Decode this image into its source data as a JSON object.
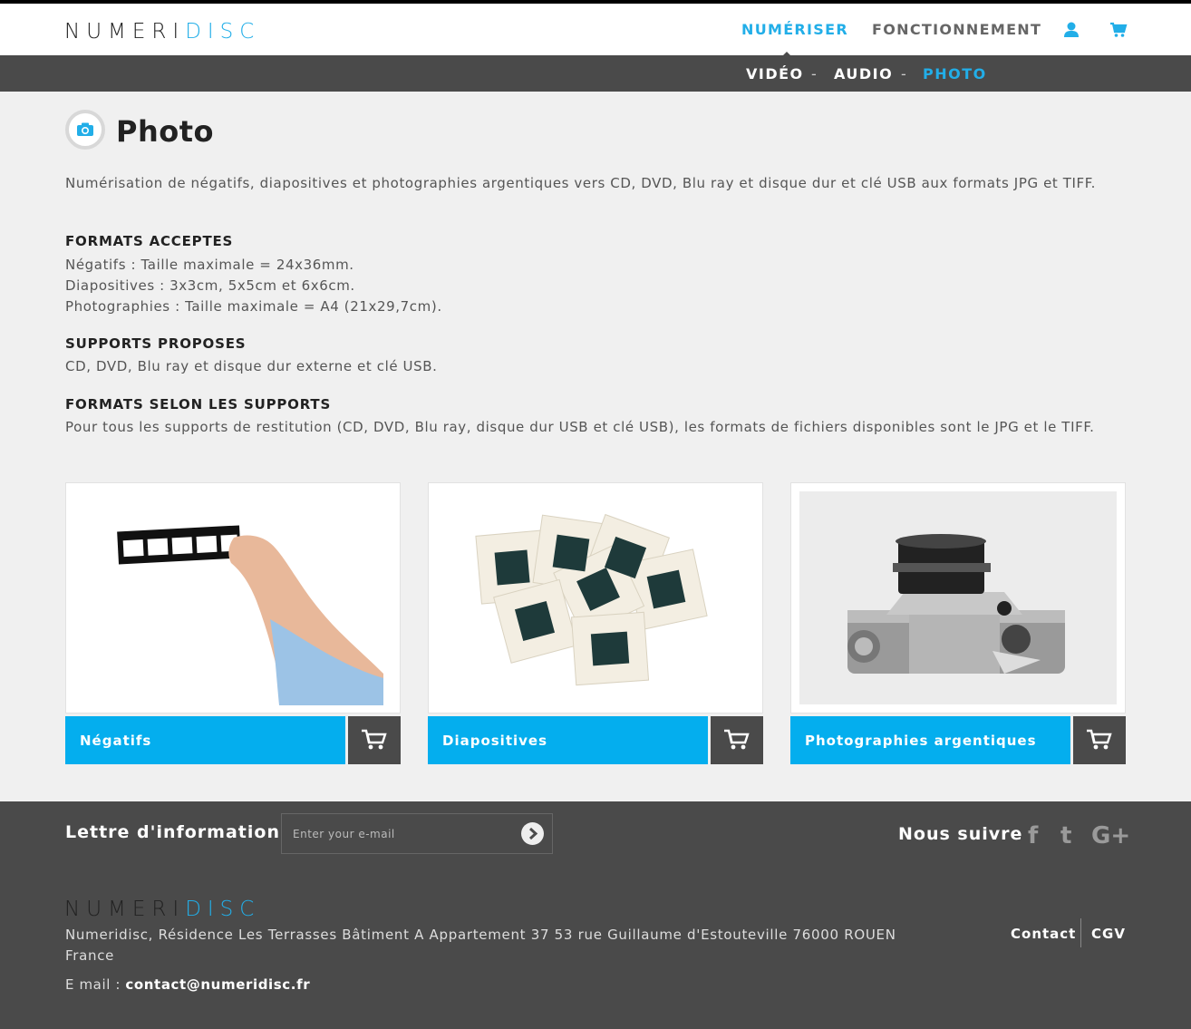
{
  "brand": {
    "part1": "NUMERI",
    "part2": "DISC"
  },
  "nav": {
    "items": [
      "NUMÉRISER",
      "FONCTIONNEMENT"
    ],
    "user_icon": "user-icon",
    "cart_icon": "cart-icon"
  },
  "subnav": {
    "items": [
      "VIDÉO",
      "AUDIO",
      "PHOTO"
    ],
    "separator": "-",
    "active": "PHOTO"
  },
  "page": {
    "title": "Photo",
    "icon": "camera-icon",
    "intro": "Numérisation de négatifs, diapositives et photographies argentiques vers CD, DVD, Blu ray et disque dur et clé USB aux formats JPG et TIFF.",
    "sections": [
      {
        "heading": "FORMATS ACCEPTES",
        "lines": [
          "Négatifs : Taille maximale = 24x36mm.",
          "Diapositives : 3x3cm, 5x5cm et 6x6cm.",
          "Photographies : Taille maximale = A4 (21x29,7cm)."
        ]
      },
      {
        "heading": "SUPPORTS PROPOSES",
        "lines": [
          "CD, DVD, Blu ray et disque dur externe et clé USB."
        ]
      },
      {
        "heading": "FORMATS SELON LES SUPPORTS",
        "lines": [
          "Pour tous les supports de restitution (CD, DVD, Blu ray, disque dur USB et clé USB), les formats de fichiers disponibles sont le JPG et le TIFF."
        ]
      }
    ]
  },
  "cards": [
    {
      "label": "Négatifs",
      "image": "hand-holding-film-strip"
    },
    {
      "label": "Diapositives",
      "image": "pile-of-slides"
    },
    {
      "label": "Photographies argentiques",
      "image": "film-camera"
    }
  ],
  "newsletter": {
    "title": "Lettre d'informations",
    "placeholder": "Enter your e-mail"
  },
  "social": {
    "title": "Nous suivre",
    "icons": [
      "facebook-icon",
      "twitter-icon",
      "google-plus-icon"
    ],
    "glyphs": [
      "f",
      "t",
      "G+"
    ]
  },
  "footer": {
    "address": "Numeridisc, Résidence Les Terrasses   Bâtiment A   Appartement 37 53 rue Guillaume d'Estouteville 76000 ROUEN France",
    "email_label": "E mail : ",
    "email": "contact@numeridisc.fr",
    "links": [
      "Contact",
      "CGV"
    ]
  },
  "colors": {
    "accent": "#04aeee",
    "dark_bar": "#4a4a4a",
    "background": "#f0f0f0"
  }
}
